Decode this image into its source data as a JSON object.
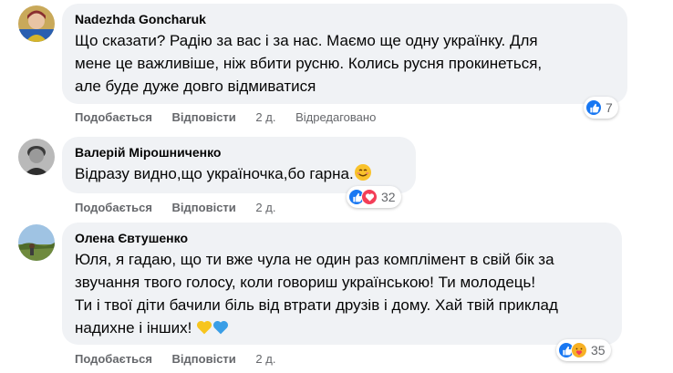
{
  "comments": [
    {
      "author": "Nadezhda Goncharuk",
      "text": "Що сказати? Радію за вас і за нас. Маємо ще одну українку. Для\nмене це важливіше, ніж вбити русню. Колись русня прокинеться,\nале буде дуже довго відмиватися",
      "like_label": "Подобається",
      "reply_label": "Відповісти",
      "time": "2 д.",
      "edited": "Відредаговано",
      "reaction_count": "7",
      "reactions": [
        "like-icon"
      ]
    },
    {
      "author": "Валерій Мірошниченко",
      "text": "Відразу видно,що україночка,бо гарна.",
      "emoji": "smiling-face-emoji",
      "like_label": "Подобається",
      "reply_label": "Відповісти",
      "time": "2 д.",
      "reaction_count": "32",
      "reactions": [
        "like-icon",
        "love-icon"
      ]
    },
    {
      "author": "Олена Євтушенко",
      "text": "Юля, я гадаю, що ти вже чула не один раз комплімент в свій бік за\nзвучання твого голосу, коли говориш українською! Ти молодець!\nТи і твої діти бачили біль від втрати друзів і дому. Хай твій приклад\nнадихне і інших!",
      "emoji": "yellow-heart-blue-heart-emoji",
      "like_label": "Подобається",
      "reply_label": "Відповісти",
      "time": "2 д.",
      "reaction_count": "35",
      "reactions": [
        "like-icon",
        "care-icon"
      ]
    }
  ],
  "colors": {
    "bubble": "#f0f2f5",
    "meta": "#65676b",
    "like_blue": "#1877f2",
    "love_red": "#f33e58",
    "care_yellow": "#f7b125"
  }
}
